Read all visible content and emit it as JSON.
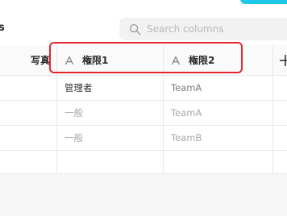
{
  "toolbar": {
    "title": "s",
    "search_placeholder": "Search columns"
  },
  "table": {
    "columns": [
      {
        "label": "写真",
        "type": ""
      },
      {
        "label": "権限1",
        "type": "text"
      },
      {
        "label": "権限2",
        "type": "text"
      }
    ],
    "rows": [
      [
        "",
        "管理者",
        "TeamA"
      ],
      [
        "",
        "一般",
        "TeamA"
      ],
      [
        "",
        "一般",
        "TeamB"
      ]
    ]
  },
  "colors": {
    "highlight": "#e5262a",
    "accent": "#1ec8e6"
  }
}
